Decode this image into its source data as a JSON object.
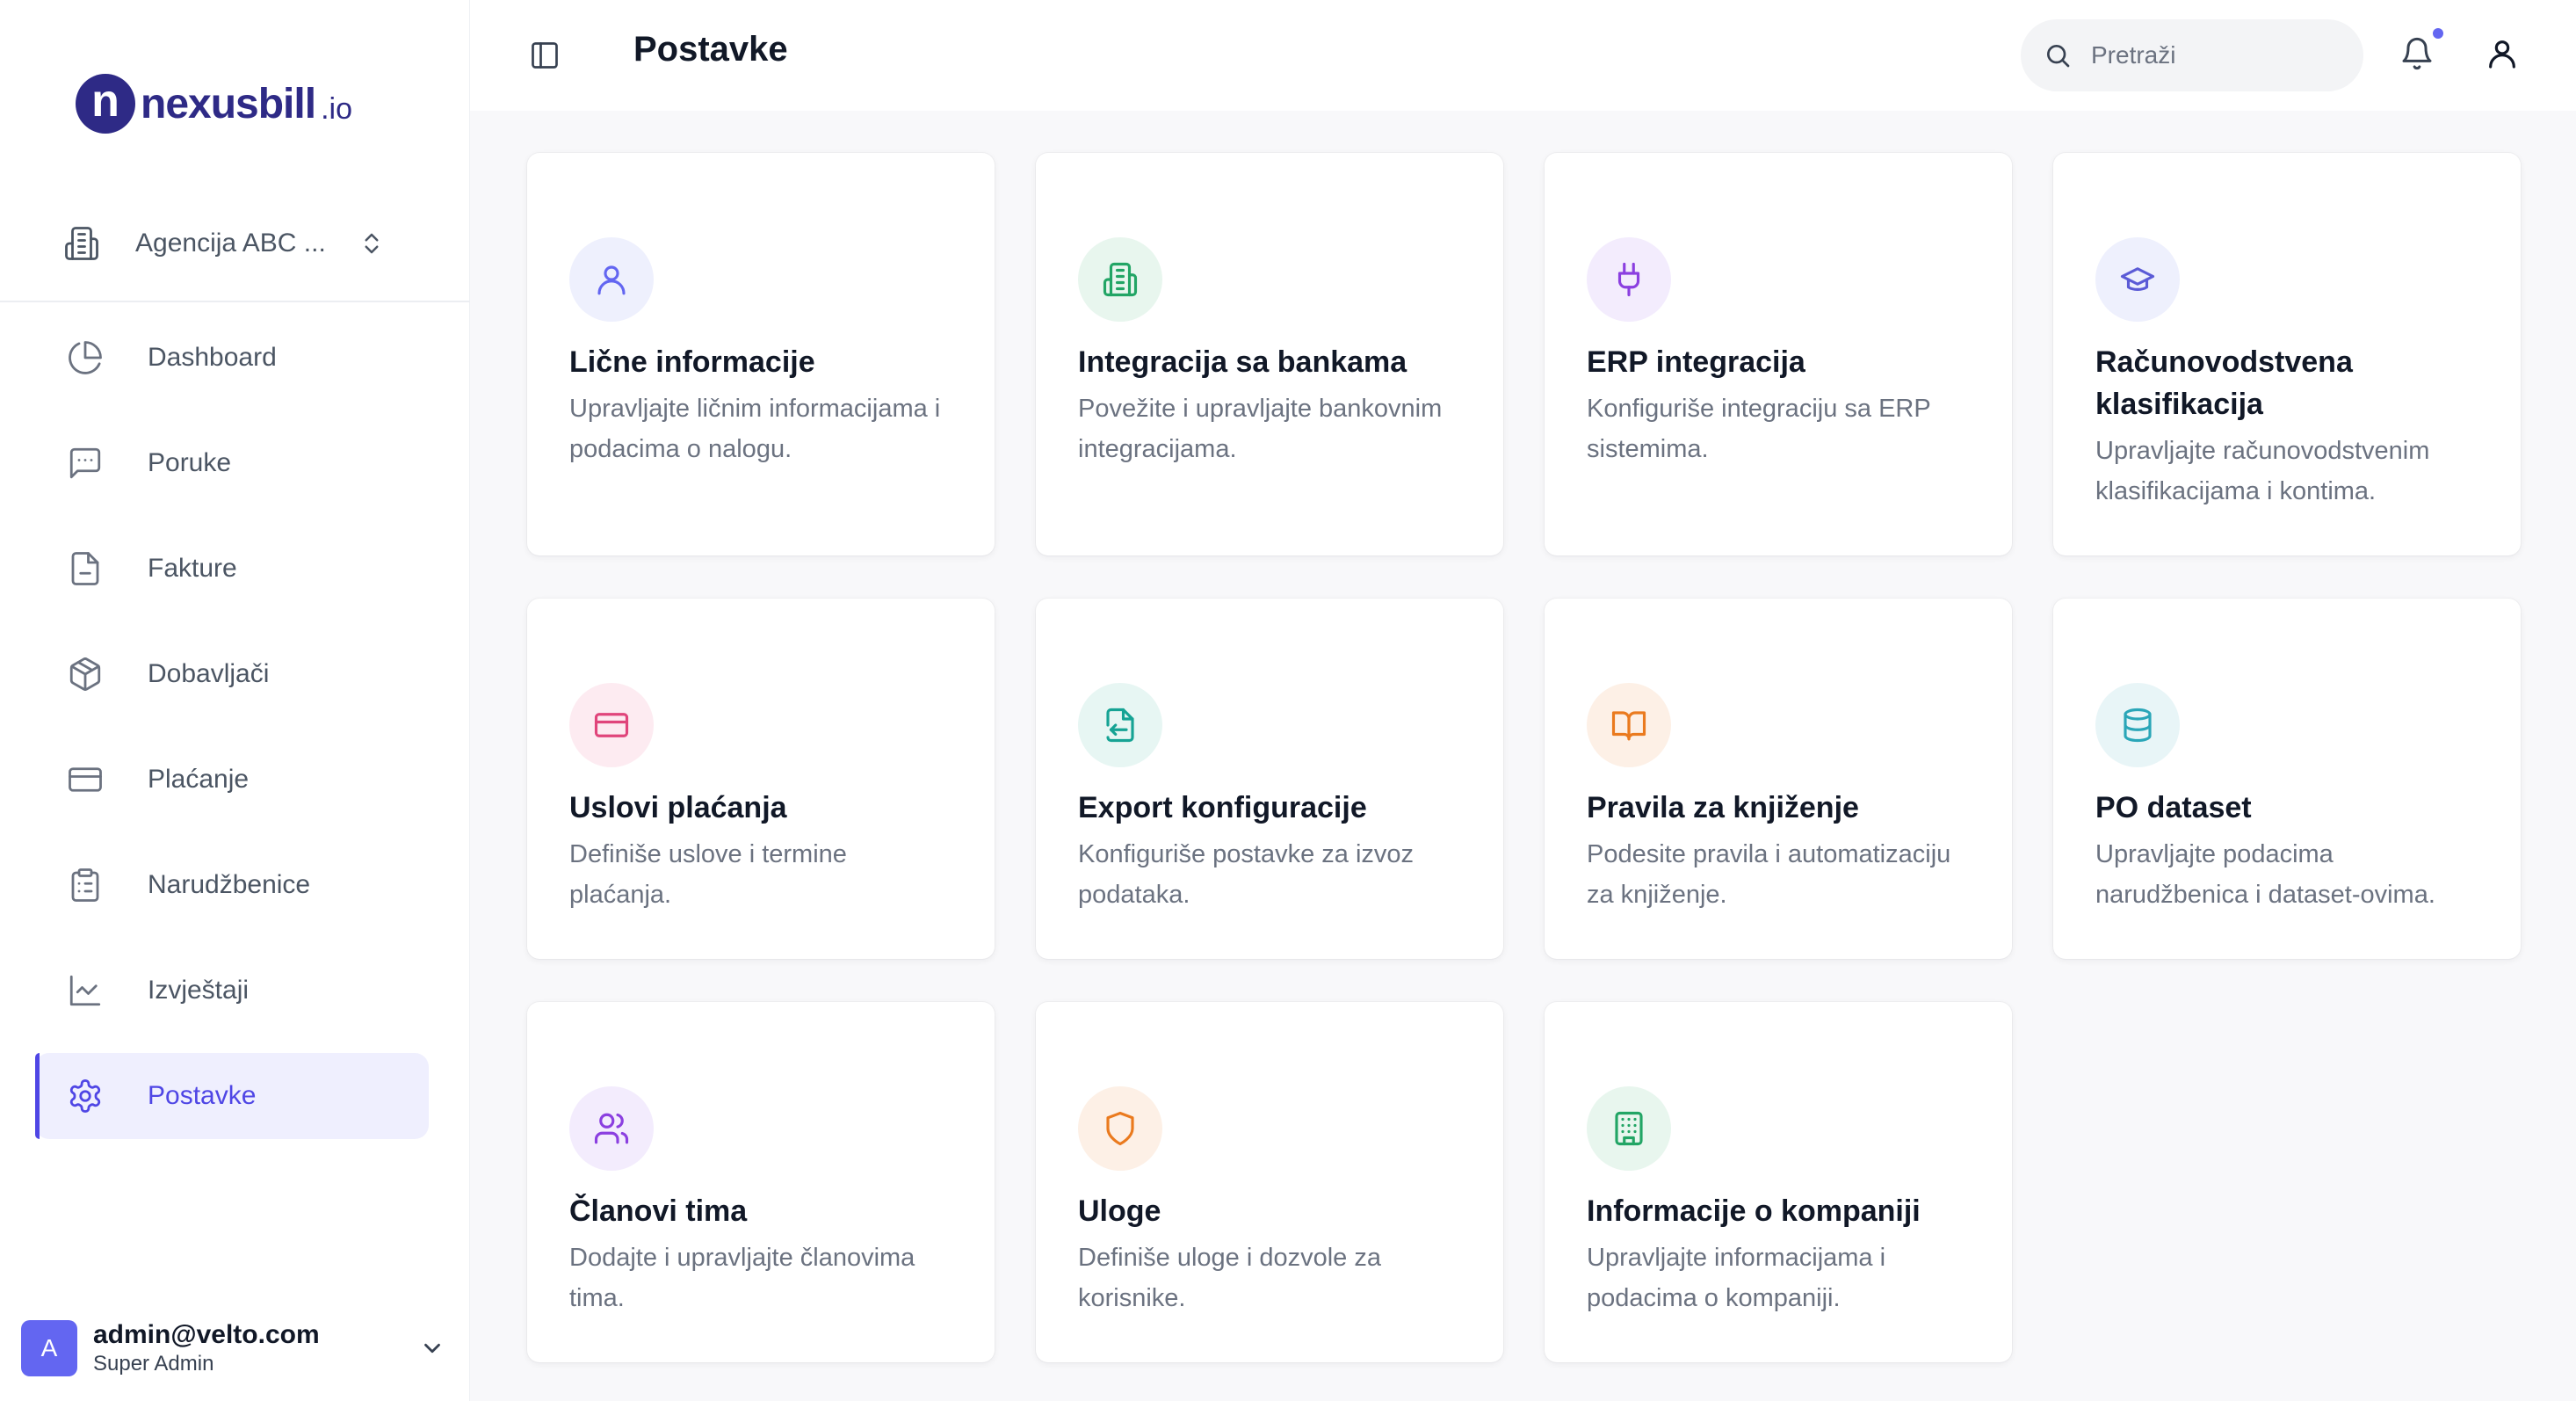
{
  "brand": {
    "mark": "n",
    "name": "nexusbill",
    "tld": ".io"
  },
  "organization": {
    "label": "Agencija ABC ..."
  },
  "nav": [
    {
      "label": "Dashboard",
      "icon": "pie-chart-icon"
    },
    {
      "label": "Poruke",
      "icon": "message-icon"
    },
    {
      "label": "Fakture",
      "icon": "file-icon"
    },
    {
      "label": "Dobavljači",
      "icon": "package-icon"
    },
    {
      "label": "Plaćanje",
      "icon": "credit-card-icon"
    },
    {
      "label": "Narudžbenice",
      "icon": "clipboard-icon"
    },
    {
      "label": "Izvještaji",
      "icon": "line-chart-icon"
    },
    {
      "label": "Postavke",
      "icon": "gear-icon",
      "active": true
    }
  ],
  "user": {
    "initial": "A",
    "email": "admin@velto.com",
    "role": "Super Admin"
  },
  "header": {
    "title": "Postavke",
    "search_placeholder": "Pretraži"
  },
  "colors": {
    "accent": "#4f46e5",
    "notification_dot": "#6366f1"
  },
  "cards": [
    {
      "title": "Lične informacije",
      "description": "Upravljajte ličnim informacijama i podacima o nalogu.",
      "icon": "user-icon",
      "color": "#6366f1",
      "bg": "#eef0fd"
    },
    {
      "title": "Integracija sa bankama",
      "description": "Povežite i upravljajte bankovnim integracijama.",
      "icon": "bank-building-icon",
      "color": "#22a565",
      "bg": "#e8f6ee"
    },
    {
      "title": "ERP integracija",
      "description": "Konfiguriše integraciju sa ERP sistemima.",
      "icon": "plug-icon",
      "color": "#8b3fe0",
      "bg": "#f3ecfd"
    },
    {
      "title": "Računovodstvena klasifikacija",
      "description": "Upravljajte računovodstvenim klasifikacijama i kontima.",
      "icon": "graduation-cap-icon",
      "color": "#5b5bd6",
      "bg": "#eef0fd"
    },
    {
      "title": "Uslovi plaćanja",
      "description": "Definiše uslove i termine plaćanja.",
      "icon": "credit-card-icon",
      "color": "#e0457b",
      "bg": "#fdebf1"
    },
    {
      "title": "Export konfiguracije",
      "description": "Konfiguriše postavke za izvoz podataka.",
      "icon": "file-export-icon",
      "color": "#16a394",
      "bg": "#e7f6f3"
    },
    {
      "title": "Pravila za knjiženje",
      "description": "Podesite pravila i automatizaciju za knjiženje.",
      "icon": "book-open-icon",
      "color": "#ea7a1e",
      "bg": "#fdf0e6"
    },
    {
      "title": "PO dataset",
      "description": "Upravljajte podacima narudžbenica i dataset-ovima.",
      "icon": "database-icon",
      "color": "#2aa6b8",
      "bg": "#e8f5f7"
    },
    {
      "title": "Članovi tima",
      "description": "Dodajte i upravljajte članovima tima.",
      "icon": "users-icon",
      "color": "#8b3fe0",
      "bg": "#f3ecfd"
    },
    {
      "title": "Uloge",
      "description": "Definiše uloge i dozvole za korisnike.",
      "icon": "shield-icon",
      "color": "#ea7a1e",
      "bg": "#fdf0e6"
    },
    {
      "title": "Informacije o kompaniji",
      "description": "Upravljajte informacijama i podacima o kompaniji.",
      "icon": "office-building-icon",
      "color": "#22a565",
      "bg": "#e8f6ee"
    }
  ]
}
